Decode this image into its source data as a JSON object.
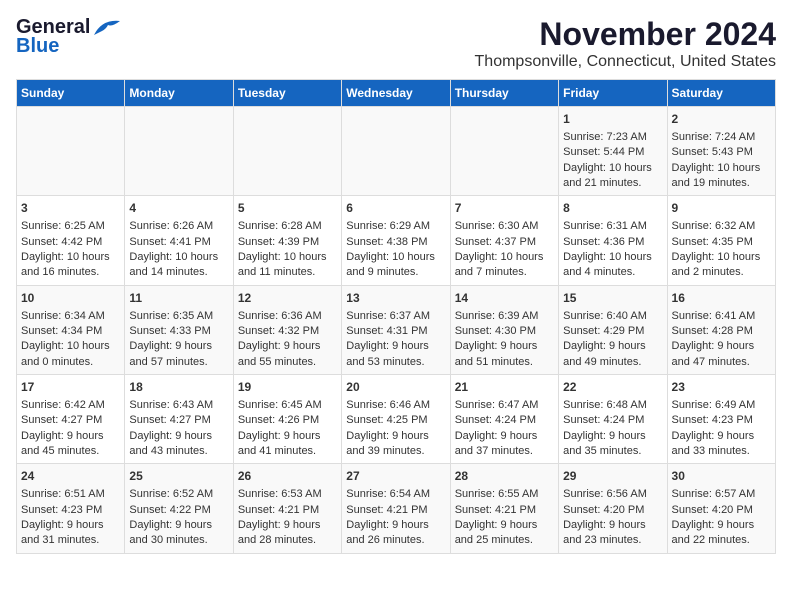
{
  "logo": {
    "line1": "General",
    "line2": "Blue"
  },
  "title": "November 2024",
  "subtitle": "Thompsonville, Connecticut, United States",
  "weekdays": [
    "Sunday",
    "Monday",
    "Tuesday",
    "Wednesday",
    "Thursday",
    "Friday",
    "Saturday"
  ],
  "weeks": [
    [
      {
        "day": "",
        "content": ""
      },
      {
        "day": "",
        "content": ""
      },
      {
        "day": "",
        "content": ""
      },
      {
        "day": "",
        "content": ""
      },
      {
        "day": "",
        "content": ""
      },
      {
        "day": "1",
        "content": "Sunrise: 7:23 AM\nSunset: 5:44 PM\nDaylight: 10 hours\nand 21 minutes."
      },
      {
        "day": "2",
        "content": "Sunrise: 7:24 AM\nSunset: 5:43 PM\nDaylight: 10 hours\nand 19 minutes."
      }
    ],
    [
      {
        "day": "3",
        "content": "Sunrise: 6:25 AM\nSunset: 4:42 PM\nDaylight: 10 hours\nand 16 minutes."
      },
      {
        "day": "4",
        "content": "Sunrise: 6:26 AM\nSunset: 4:41 PM\nDaylight: 10 hours\nand 14 minutes."
      },
      {
        "day": "5",
        "content": "Sunrise: 6:28 AM\nSunset: 4:39 PM\nDaylight: 10 hours\nand 11 minutes."
      },
      {
        "day": "6",
        "content": "Sunrise: 6:29 AM\nSunset: 4:38 PM\nDaylight: 10 hours\nand 9 minutes."
      },
      {
        "day": "7",
        "content": "Sunrise: 6:30 AM\nSunset: 4:37 PM\nDaylight: 10 hours\nand 7 minutes."
      },
      {
        "day": "8",
        "content": "Sunrise: 6:31 AM\nSunset: 4:36 PM\nDaylight: 10 hours\nand 4 minutes."
      },
      {
        "day": "9",
        "content": "Sunrise: 6:32 AM\nSunset: 4:35 PM\nDaylight: 10 hours\nand 2 minutes."
      }
    ],
    [
      {
        "day": "10",
        "content": "Sunrise: 6:34 AM\nSunset: 4:34 PM\nDaylight: 10 hours\nand 0 minutes."
      },
      {
        "day": "11",
        "content": "Sunrise: 6:35 AM\nSunset: 4:33 PM\nDaylight: 9 hours\nand 57 minutes."
      },
      {
        "day": "12",
        "content": "Sunrise: 6:36 AM\nSunset: 4:32 PM\nDaylight: 9 hours\nand 55 minutes."
      },
      {
        "day": "13",
        "content": "Sunrise: 6:37 AM\nSunset: 4:31 PM\nDaylight: 9 hours\nand 53 minutes."
      },
      {
        "day": "14",
        "content": "Sunrise: 6:39 AM\nSunset: 4:30 PM\nDaylight: 9 hours\nand 51 minutes."
      },
      {
        "day": "15",
        "content": "Sunrise: 6:40 AM\nSunset: 4:29 PM\nDaylight: 9 hours\nand 49 minutes."
      },
      {
        "day": "16",
        "content": "Sunrise: 6:41 AM\nSunset: 4:28 PM\nDaylight: 9 hours\nand 47 minutes."
      }
    ],
    [
      {
        "day": "17",
        "content": "Sunrise: 6:42 AM\nSunset: 4:27 PM\nDaylight: 9 hours\nand 45 minutes."
      },
      {
        "day": "18",
        "content": "Sunrise: 6:43 AM\nSunset: 4:27 PM\nDaylight: 9 hours\nand 43 minutes."
      },
      {
        "day": "19",
        "content": "Sunrise: 6:45 AM\nSunset: 4:26 PM\nDaylight: 9 hours\nand 41 minutes."
      },
      {
        "day": "20",
        "content": "Sunrise: 6:46 AM\nSunset: 4:25 PM\nDaylight: 9 hours\nand 39 minutes."
      },
      {
        "day": "21",
        "content": "Sunrise: 6:47 AM\nSunset: 4:24 PM\nDaylight: 9 hours\nand 37 minutes."
      },
      {
        "day": "22",
        "content": "Sunrise: 6:48 AM\nSunset: 4:24 PM\nDaylight: 9 hours\nand 35 minutes."
      },
      {
        "day": "23",
        "content": "Sunrise: 6:49 AM\nSunset: 4:23 PM\nDaylight: 9 hours\nand 33 minutes."
      }
    ],
    [
      {
        "day": "24",
        "content": "Sunrise: 6:51 AM\nSunset: 4:23 PM\nDaylight: 9 hours\nand 31 minutes."
      },
      {
        "day": "25",
        "content": "Sunrise: 6:52 AM\nSunset: 4:22 PM\nDaylight: 9 hours\nand 30 minutes."
      },
      {
        "day": "26",
        "content": "Sunrise: 6:53 AM\nSunset: 4:21 PM\nDaylight: 9 hours\nand 28 minutes."
      },
      {
        "day": "27",
        "content": "Sunrise: 6:54 AM\nSunset: 4:21 PM\nDaylight: 9 hours\nand 26 minutes."
      },
      {
        "day": "28",
        "content": "Sunrise: 6:55 AM\nSunset: 4:21 PM\nDaylight: 9 hours\nand 25 minutes."
      },
      {
        "day": "29",
        "content": "Sunrise: 6:56 AM\nSunset: 4:20 PM\nDaylight: 9 hours\nand 23 minutes."
      },
      {
        "day": "30",
        "content": "Sunrise: 6:57 AM\nSunset: 4:20 PM\nDaylight: 9 hours\nand 22 minutes."
      }
    ]
  ]
}
